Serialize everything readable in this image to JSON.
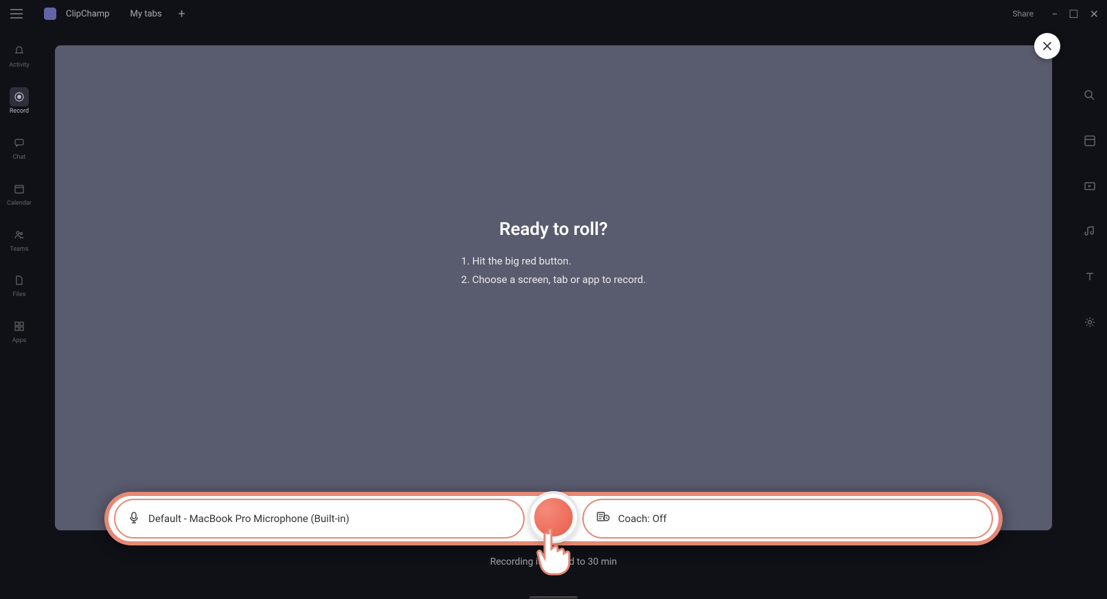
{
  "topbar": {
    "app_title": "ClipChamp",
    "tab_label": "My tabs",
    "share_label": "Share"
  },
  "leftnav": {
    "items": [
      {
        "label": "Activity"
      },
      {
        "label": "Record"
      },
      {
        "label": "Chat"
      },
      {
        "label": "Calendar"
      },
      {
        "label": "Teams"
      },
      {
        "label": "Files"
      },
      {
        "label": "Apps"
      }
    ]
  },
  "modal": {
    "heading": "Ready to roll?",
    "step1": "1. Hit the big red button.",
    "step2": "2. Choose a screen, tab or app to record."
  },
  "controls": {
    "mic_label": "Default - MacBook Pro Microphone (Built-in)",
    "coach_label": "Coach: Off"
  },
  "limit_text": "Recording is limited to 30 min"
}
